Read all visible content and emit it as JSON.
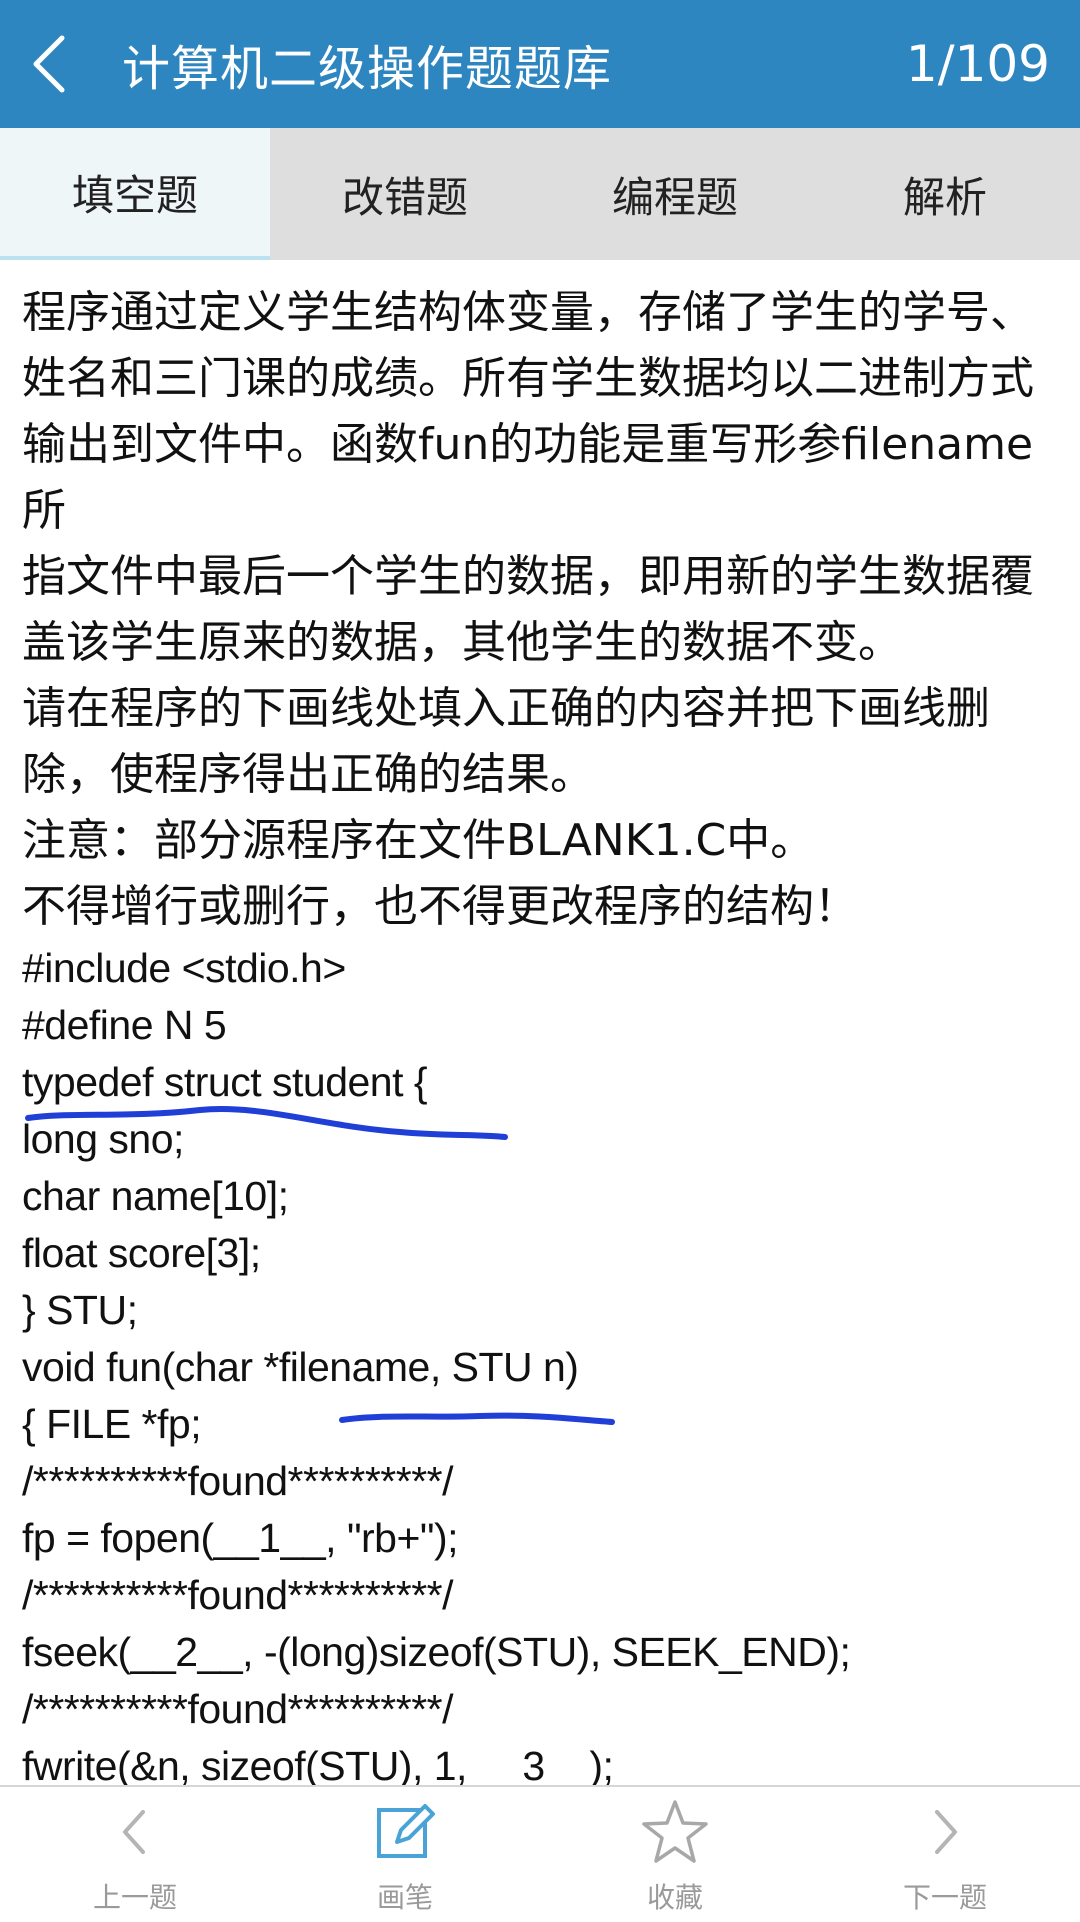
{
  "header": {
    "title": "计算机二级操作题题库",
    "counter": "1/109"
  },
  "tabs": [
    "填空题",
    "改错题",
    "编程题",
    "解析"
  ],
  "question": {
    "paragraphs": [
      "程序通过定义学生结构体变量，存储了学生的学号、",
      "姓名和三门课的成绩。所有学生数据均以二进制方式",
      "输出到文件中。函数fun的功能是重写形参filename所",
      "指文件中最后一个学生的数据，即用新的学生数据覆",
      "盖该学生原来的数据，其他学生的数据不变。",
      "请在程序的下画线处填入正确的内容并把下画线删",
      "除，使程序得出正确的结果。",
      "注意：部分源程序在文件BLANK1.C中。",
      "不得增行或删行，也不得更改程序的结构！"
    ],
    "code": [
      "#include <stdio.h>",
      "#define N 5",
      "typedef struct student {",
      "long sno;",
      "char name[10];",
      "float score[3];",
      "} STU;",
      "void fun(char *filename, STU n)",
      "{ FILE *fp;",
      "/**********found**********/",
      "fp = fopen(__1__, \"rb+\");",
      "/**********found**********/",
      "fseek(__2__, -(long)sizeof(STU), SEEK_END);",
      "/**********found**********/",
      "fwrite(&n, sizeof(STU), 1, __3__);"
    ]
  },
  "bottom_nav": {
    "prev": "上一题",
    "pen": "画笔",
    "favorite": "收藏",
    "next": "下一题"
  },
  "colors": {
    "header_bg": "#2e86c1",
    "pen_stroke": "#1f3fd6",
    "pen_icon": "#4aa3d6"
  }
}
